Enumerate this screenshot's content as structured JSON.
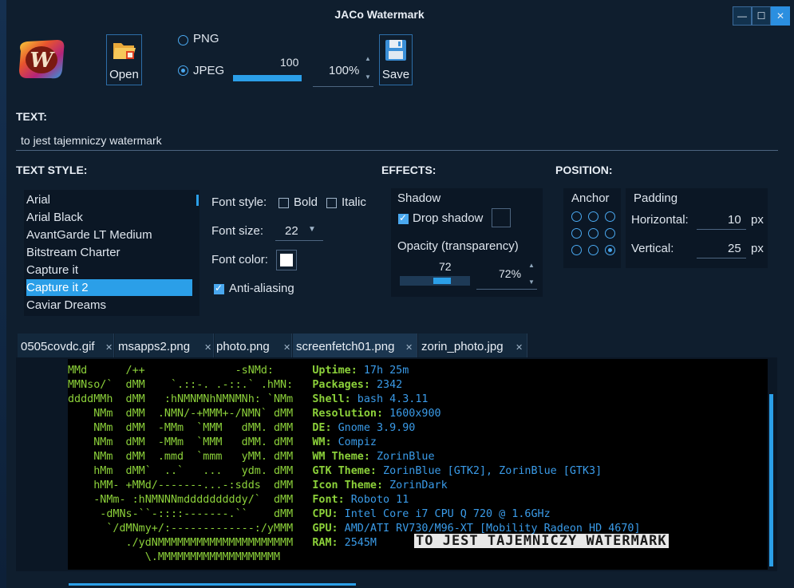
{
  "window": {
    "title": "JACo Watermark",
    "min_icon": "minimize-icon",
    "max_icon": "maximize-icon",
    "close_icon": "close-icon"
  },
  "toolbar": {
    "open_label": "Open",
    "save_label": "Save",
    "format_png": "PNG",
    "format_jpeg": "JPEG",
    "selected_format": "JPEG",
    "quality_value": "100",
    "quality_fraction": 1.0,
    "quality_percent": "100%"
  },
  "text_section": {
    "header": "TEXT:",
    "value": "to jest tajemniczy watermark"
  },
  "text_style": {
    "header": "TEXT STYLE:",
    "fonts": [
      "Arial",
      "Arial Black",
      "AvantGarde LT Medium",
      "Bitstream Charter",
      "Capture it",
      "Capture it 2",
      "Caviar Dreams"
    ],
    "selected_font": "Capture it 2",
    "font_style_label": "Font style:",
    "bold_label": "Bold",
    "bold_checked": false,
    "italic_label": "Italic",
    "italic_checked": false,
    "font_size_label": "Font size:",
    "font_size_value": "22",
    "font_color_label": "Font color:",
    "font_color": "#ffffff",
    "antialias_label": "Anti-aliasing",
    "antialias_checked": true
  },
  "effects": {
    "header": "EFFECTS:",
    "shadow_label": "Shadow",
    "drop_shadow_label": "Drop shadow",
    "drop_shadow_checked": true,
    "shadow_color": "#0b1725",
    "opacity_label": "Opacity (transparency)",
    "opacity_value": "72",
    "opacity_fraction": 0.72,
    "opacity_percent": "72%"
  },
  "position": {
    "header": "POSITION:",
    "anchor_label": "Anchor",
    "anchor_selected": "bottom-right",
    "padding_label": "Padding",
    "horizontal_label": "Horizontal:",
    "horizontal_value": "10",
    "vertical_label": "Vertical:",
    "vertical_value": "25",
    "unit": "px"
  },
  "tabs": [
    {
      "label": "0505covdc.gif"
    },
    {
      "label": "msapps2.png"
    },
    {
      "label": "photo.png"
    },
    {
      "label": "screenfetch01.png",
      "active": true
    },
    {
      "label": "zorin_photo.jpg"
    }
  ],
  "preview": {
    "lines": [
      {
        "art": "MMd      /++              -sNMd:",
        "key": "Uptime:",
        "val": "17h 25m"
      },
      {
        "art": "MMNso/`  dMM    `.::-. .-::.` .hMN:",
        "key": "Packages:",
        "val": "2342"
      },
      {
        "art": "ddddMMh  dMM   :hNMNMNhNMNMNh: `NMm",
        "key": "Shell:",
        "val": "bash 4.3.11"
      },
      {
        "art": "    NMm  dMM  .NMN/-+MMM+-/NMN` dMM",
        "key": "Resolution:",
        "val": "1600x900"
      },
      {
        "art": "    NMm  dMM  -MMm  `MMM   dMM. dMM",
        "key": "DE:",
        "val": "Gnome 3.9.90"
      },
      {
        "art": "    NMm  dMM  -MMm  `MMM   dMM. dMM",
        "key": "WM:",
        "val": "Compiz"
      },
      {
        "art": "    NMm  dMM  .mmd  `mmm   yMM. dMM",
        "key": "WM Theme:",
        "val": "ZorinBlue"
      },
      {
        "art": "    hMm  dMM`  ..`   ...   ydm. dMM",
        "key": "GTK Theme:",
        "val": "ZorinBlue [GTK2], ZorinBlue [GTK3]"
      },
      {
        "art": "    hMM- +MMd/-------...-:sdds  dMM",
        "key": "Icon Theme:",
        "val": "ZorinDark"
      },
      {
        "art": "    -NMm- :hNMNNNmdddddddddy/`  dMM",
        "key": "Font:",
        "val": "Roboto 11"
      },
      {
        "art": "     -dMNs-``-::::-------.``    dMM",
        "key": "CPU:",
        "val": "Intel Core i7 CPU Q 720 @ 1.6GHz"
      },
      {
        "art": "      `/dMNmy+/:-------------:/yMMM",
        "key": "GPU:",
        "val": "AMD/ATI RV730/M96-XT [Mobility Radeon HD 4670]"
      },
      {
        "art": "         ./ydNMMMMMMMMMMMMMMMMMMMMM",
        "key": "RAM:",
        "val": "2545M"
      },
      {
        "art": "            \\.MMMMMMMMMMMMMMMMMMM",
        "key": "",
        "val": ""
      }
    ],
    "watermark_text": "TO JEST TAJEMNICZY WATERMARK"
  },
  "colors": {
    "accent": "#2b9fe8",
    "background": "#0f1e2e",
    "art_green": "#8cd13a",
    "info_blue": "#3a9be8"
  }
}
